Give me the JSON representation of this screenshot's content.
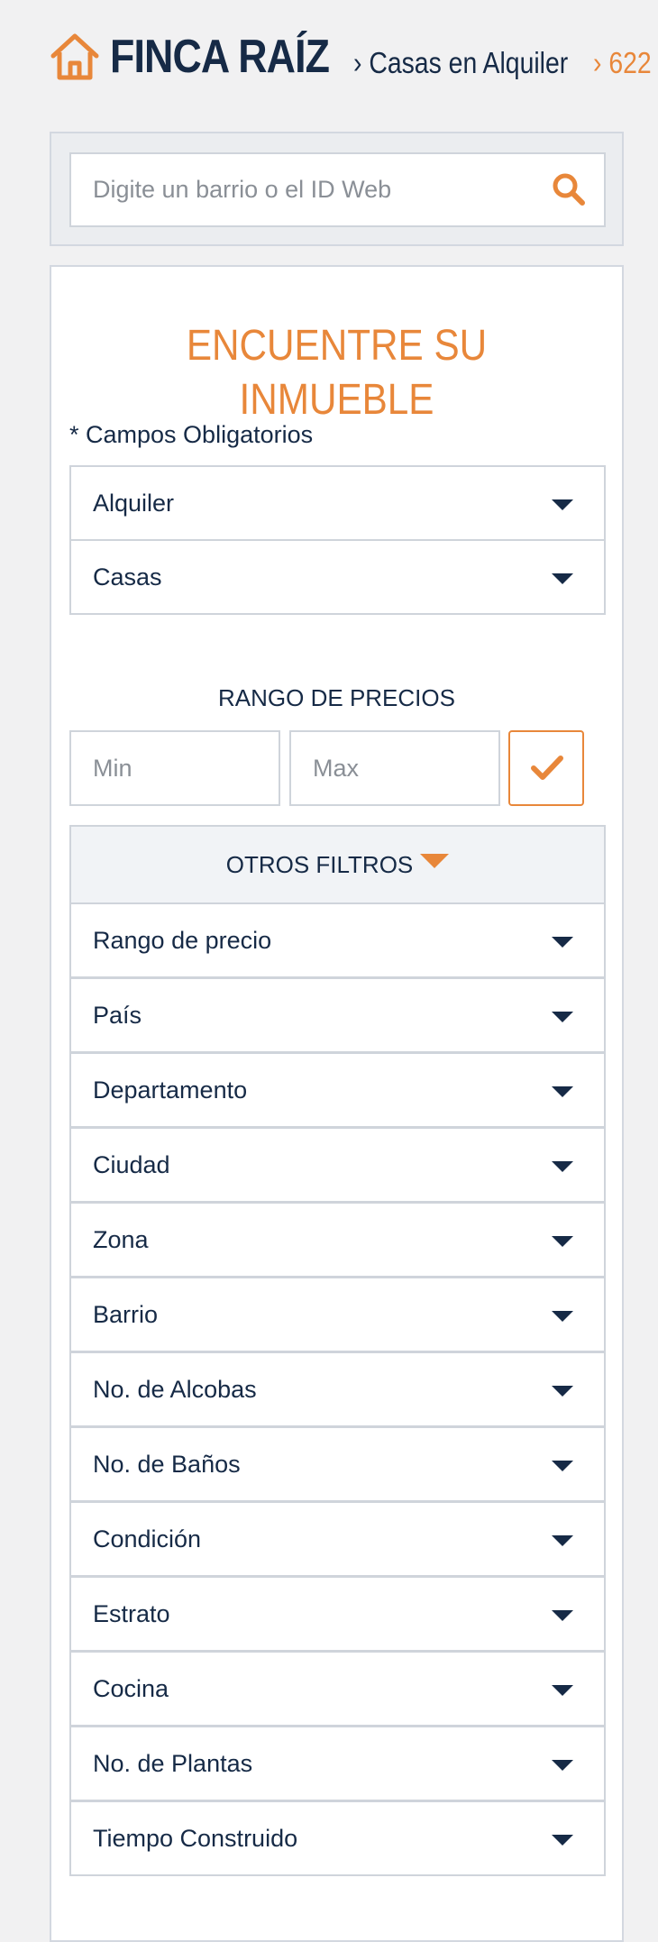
{
  "header": {
    "brand": "FINCA RAÍZ",
    "breadcrumbs": [
      "› Casas en Alquiler",
      "› 622"
    ],
    "icon": "house-icon"
  },
  "search": {
    "placeholder": "Digite un barrio o el ID Web",
    "icon": "search-icon"
  },
  "form": {
    "title": "ENCUENTRE SU INMUEBLE",
    "required_note": "* Campos Obligatorios",
    "operation": "Alquiler",
    "property_type": "Casas",
    "price_range_title": "RANGO DE PRECIOS",
    "min_placeholder": "Min",
    "max_placeholder": "Max",
    "other_filters_label": "OTROS FILTROS",
    "filters": [
      "Rango de precio",
      "País",
      "Departamento",
      "Ciudad",
      "Zona",
      "Barrio",
      "No. de Alcobas",
      "No. de Baños",
      "Condición",
      "Estrato",
      "Cocina",
      "No. de Plantas",
      "Tiempo Construido"
    ]
  },
  "colors": {
    "accent": "#e8873a",
    "text": "#162a46",
    "background": "#f1f1f2"
  }
}
